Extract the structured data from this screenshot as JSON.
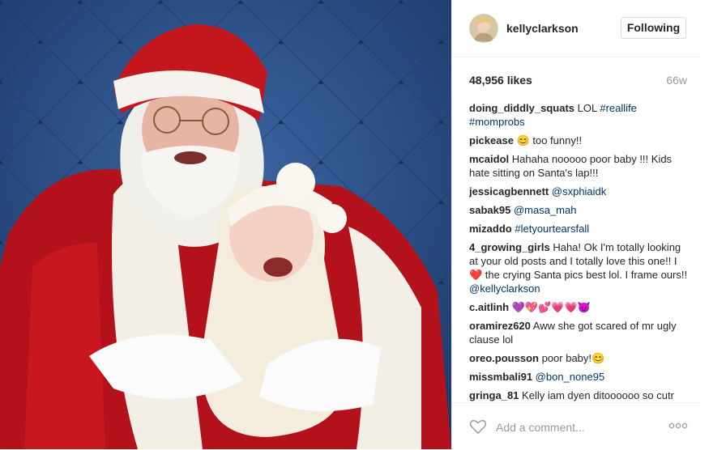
{
  "header": {
    "username": "kellyclarkson",
    "follow_label": "Following"
  },
  "stats": {
    "likes": "48,956 likes",
    "time": "66w"
  },
  "comments": [
    {
      "user": "doing_diddly_squats",
      "parts": [
        "LOL ",
        "#reallife",
        " ",
        "#momprobs"
      ],
      "tags": [
        false,
        true,
        false,
        true
      ]
    },
    {
      "user": "pickease",
      "parts": [
        "😊 too funny!!"
      ],
      "tags": [
        false
      ]
    },
    {
      "user": "mcaidol",
      "parts": [
        "Hahaha nooooo poor baby !!! Kids hate sitting on Santa's lap!!!"
      ],
      "tags": [
        false
      ]
    },
    {
      "user": "jessicagbennett",
      "parts": [
        "@sxphiaidk"
      ],
      "tags": [
        true
      ]
    },
    {
      "user": "sabak95",
      "parts": [
        "@masa_mah"
      ],
      "tags": [
        true
      ]
    },
    {
      "user": "mizaddo",
      "parts": [
        "#letyourtearsfall"
      ],
      "tags": [
        true
      ]
    },
    {
      "user": "4_growing_girls",
      "parts": [
        "Haha! Ok I'm totally looking at your old posts and I totally love this one!! I ❤️ the crying Santa pics best lol. I frame ours!! ",
        "@kellyclarkson"
      ],
      "tags": [
        false,
        true
      ]
    },
    {
      "user": "c.aitlinh",
      "parts": [
        "💜💖💕💗💗😈"
      ],
      "tags": [
        false
      ]
    },
    {
      "user": "oramirez620",
      "parts": [
        "Aww she got scared of mr ugly clause lol"
      ],
      "tags": [
        false
      ]
    },
    {
      "user": "oreo.pousson",
      "parts": [
        "poor baby!😊"
      ],
      "tags": [
        false
      ]
    },
    {
      "user": "missmbali91",
      "parts": [
        "@bon_none95"
      ],
      "tags": [
        true
      ]
    },
    {
      "user": "gringa_81",
      "parts": [
        "Kelly iam dyen ditoooooo so cutr"
      ],
      "tags": [
        false
      ]
    }
  ],
  "footer": {
    "add_comment_placeholder": "Add a comment..."
  },
  "icons": {
    "like": "heart-outline-icon",
    "more": "more-options-icon"
  },
  "colors": {
    "link": "#003569",
    "username": "#262626",
    "muted": "#999999",
    "backdrop": "#2c4f86"
  }
}
